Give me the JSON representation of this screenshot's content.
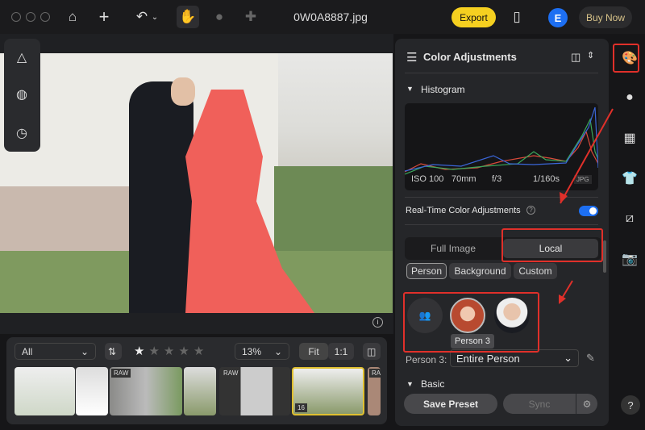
{
  "topbar": {
    "filename": "0W0A8887.jpg",
    "export_label": "Export",
    "avatar_letter": "E",
    "buy_label": "Buy Now"
  },
  "filmstrip": {
    "filter": "All",
    "rating": 1,
    "rating_max": 5,
    "zoom": "13%",
    "fit_label": "Fit",
    "one_to_one_label": "1:1",
    "thumbs": [
      {
        "badge": ""
      },
      {
        "badge": ""
      },
      {
        "badge": "RAW"
      },
      {
        "badge": ""
      },
      {
        "badge": "RAW"
      },
      {
        "badge": "",
        "index": "16",
        "selected": true
      },
      {
        "badge": "RAW"
      }
    ]
  },
  "panel": {
    "title": "Color Adjustments",
    "histogram_label": "Histogram",
    "exif": {
      "iso": "ISO 100",
      "focal": "70mm",
      "aperture": "f/3",
      "shutter": "1/160s",
      "format": "JPG"
    },
    "realtime_label": "Real-Time Color Adjustments",
    "realtime_on": true,
    "tabs": [
      "Full Image",
      "Local"
    ],
    "active_tab": "Local",
    "chips": [
      "Person",
      "Background",
      "Custom"
    ],
    "active_chip": "Person",
    "tooltip": "Person 3",
    "person_label": "Person 3:",
    "person_select": "Entire Person",
    "basic_label": "Basic",
    "save_preset": "Save Preset",
    "sync": "Sync"
  },
  "colors": {
    "accent": "#1d6ff2",
    "export": "#f5d020",
    "annotation": "#e0302a",
    "mask": "#f0605a"
  }
}
